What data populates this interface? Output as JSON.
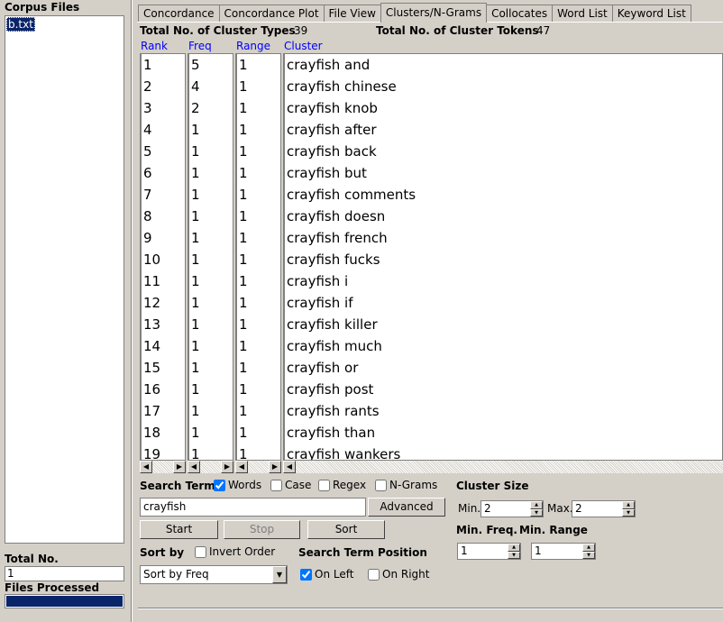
{
  "left_panel": {
    "corpus_files_label": "Corpus Files",
    "corpus_files": [
      "b.txt"
    ],
    "total_no_label": "Total No.",
    "total_no_value": "1",
    "files_processed_label": "Files Processed",
    "files_processed_fraction": 1.0
  },
  "tabs": [
    {
      "label": "Concordance",
      "active": false
    },
    {
      "label": "Concordance Plot",
      "active": false
    },
    {
      "label": "File View",
      "active": false
    },
    {
      "label": "Clusters/N-Grams",
      "active": true
    },
    {
      "label": "Collocates",
      "active": false
    },
    {
      "label": "Word List",
      "active": false
    },
    {
      "label": "Keyword List",
      "active": false
    }
  ],
  "stats": {
    "types_label": "Total No. of Cluster Types",
    "types_value": "39",
    "tokens_label": "Total No. of Cluster Tokens",
    "tokens_value": "47"
  },
  "columns": {
    "rank": "Rank",
    "freq": "Freq",
    "range": "Range",
    "cluster": "Cluster"
  },
  "rows": [
    {
      "rank": "1",
      "freq": "5",
      "range": "1",
      "cluster": "crayfish and"
    },
    {
      "rank": "2",
      "freq": "4",
      "range": "1",
      "cluster": "crayfish chinese"
    },
    {
      "rank": "3",
      "freq": "2",
      "range": "1",
      "cluster": "crayfish knob"
    },
    {
      "rank": "4",
      "freq": "1",
      "range": "1",
      "cluster": "crayfish after"
    },
    {
      "rank": "5",
      "freq": "1",
      "range": "1",
      "cluster": "crayfish back"
    },
    {
      "rank": "6",
      "freq": "1",
      "range": "1",
      "cluster": "crayfish but"
    },
    {
      "rank": "7",
      "freq": "1",
      "range": "1",
      "cluster": "crayfish comments"
    },
    {
      "rank": "8",
      "freq": "1",
      "range": "1",
      "cluster": "crayfish doesn"
    },
    {
      "rank": "9",
      "freq": "1",
      "range": "1",
      "cluster": "crayfish french"
    },
    {
      "rank": "10",
      "freq": "1",
      "range": "1",
      "cluster": "crayfish fucks"
    },
    {
      "rank": "11",
      "freq": "1",
      "range": "1",
      "cluster": "crayfish i"
    },
    {
      "rank": "12",
      "freq": "1",
      "range": "1",
      "cluster": "crayfish if"
    },
    {
      "rank": "13",
      "freq": "1",
      "range": "1",
      "cluster": "crayfish killer"
    },
    {
      "rank": "14",
      "freq": "1",
      "range": "1",
      "cluster": "crayfish much"
    },
    {
      "rank": "15",
      "freq": "1",
      "range": "1",
      "cluster": "crayfish or"
    },
    {
      "rank": "16",
      "freq": "1",
      "range": "1",
      "cluster": "crayfish post"
    },
    {
      "rank": "17",
      "freq": "1",
      "range": "1",
      "cluster": "crayfish rants"
    },
    {
      "rank": "18",
      "freq": "1",
      "range": "1",
      "cluster": "crayfish than"
    },
    {
      "rank": "19",
      "freq": "1",
      "range": "1",
      "cluster": "crayfish wankers"
    }
  ],
  "search": {
    "search_term_label": "Search Term",
    "words_label": "Words",
    "words_checked": true,
    "case_label": "Case",
    "case_checked": false,
    "regex_label": "Regex",
    "regex_checked": false,
    "ngrams_label": "N-Grams",
    "ngrams_checked": false,
    "value": "crayfish",
    "advanced_label": "Advanced",
    "start_label": "Start",
    "stop_label": "Stop",
    "sort_label": "Sort"
  },
  "sorting": {
    "sort_by_label": "Sort by",
    "invert_label": "Invert Order",
    "invert_checked": false,
    "selected": "Sort by Freq",
    "position_label": "Search Term Position",
    "on_left_label": "On Left",
    "on_left_checked": true,
    "on_right_label": "On Right",
    "on_right_checked": false
  },
  "cluster_size": {
    "label": "Cluster Size",
    "min_label": "Min.",
    "min_value": "2",
    "max_label": "Max.",
    "max_value": "2",
    "min_freq_label": "Min. Freq.",
    "min_freq_value": "1",
    "min_range_label": "Min. Range",
    "min_range_value": "1"
  },
  "colors": {
    "panel": "#d4d0c8",
    "selection": "#0a246a",
    "header_text": "#0000ff"
  }
}
